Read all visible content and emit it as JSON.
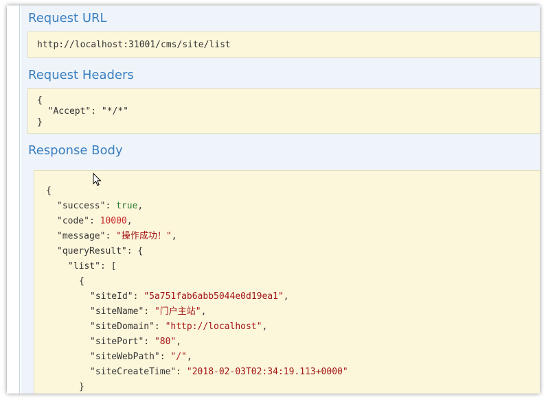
{
  "sections": {
    "request_url": {
      "title": "Request URL",
      "value": "http://localhost:31001/cms/site/list"
    },
    "request_headers": {
      "title": "Request Headers",
      "lines": [
        "{",
        "  \"Accept\": \"*/*\"",
        "}"
      ]
    },
    "response_body": {
      "title": "Response Body"
    }
  },
  "response": {
    "open_brace": "{",
    "success_key": "\"success\"",
    "success_val": "true",
    "code_key": "\"code\"",
    "code_val": "10000",
    "message_key": "\"message\"",
    "message_val": "\"操作成功！\"",
    "queryResult_key": "\"queryResult\"",
    "list_key": "\"list\"",
    "item_open": "{",
    "siteId_key": "\"siteId\"",
    "siteId_val": "\"5a751fab6abb5044e0d19ea1\"",
    "siteName_key": "\"siteName\"",
    "siteName_val": "\"门户主站\"",
    "siteDomain_key": "\"siteDomain\"",
    "siteDomain_val": "\"http://localhost\"",
    "sitePort_key": "\"sitePort\"",
    "sitePort_val": "\"80\"",
    "siteWebPath_key": "\"siteWebPath\"",
    "siteWebPath_val": "\"/\"",
    "siteCreateTime_key": "\"siteCreateTime\"",
    "siteCreateTime_val": "\"2018-02-03T02:34:19.113+0000\"",
    "item_close": "}"
  }
}
